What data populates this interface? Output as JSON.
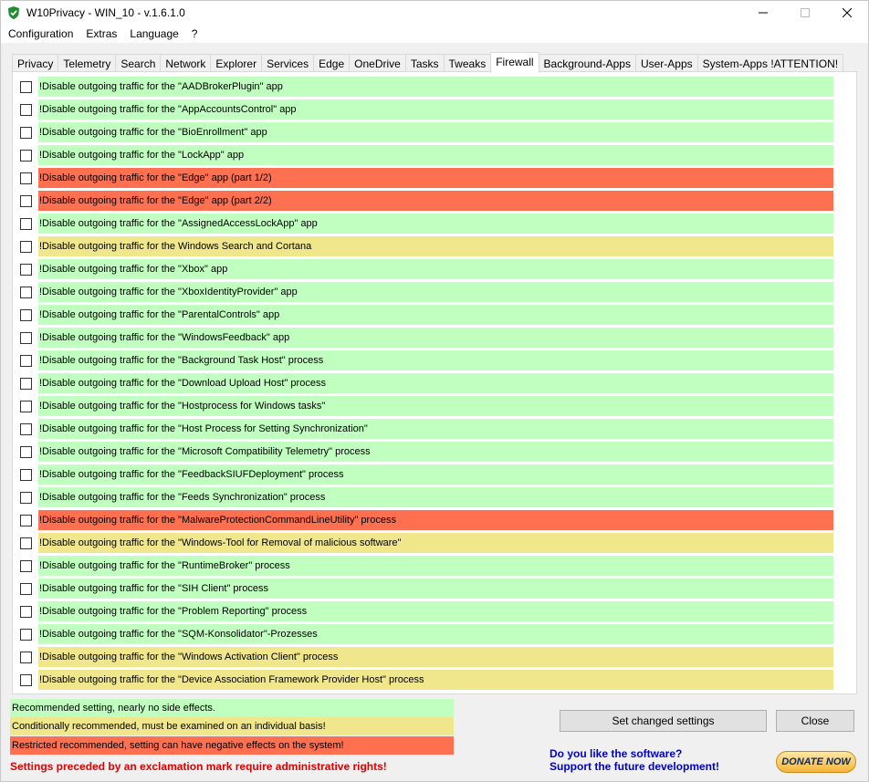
{
  "window": {
    "title": "W10Privacy - WIN_10 - v.1.6.1.0"
  },
  "menu": [
    "Configuration",
    "Extras",
    "Language",
    "?"
  ],
  "tabs": [
    "Privacy",
    "Telemetry",
    "Search",
    "Network",
    "Explorer",
    "Services",
    "Edge",
    "OneDrive",
    "Tasks",
    "Tweaks",
    "Firewall",
    "Background-Apps",
    "User-Apps",
    "System-Apps !ATTENTION!"
  ],
  "active_tab": "Firewall",
  "colors": {
    "green": "#c0ffc0",
    "yellow": "#f0e68c",
    "red": "#ff7050"
  },
  "rules": [
    {
      "label": "!Disable outgoing traffic for the \"AADBrokerPlugin\" app",
      "level": "green",
      "checked": false
    },
    {
      "label": "!Disable outgoing traffic for the \"AppAccountsControl\" app",
      "level": "green",
      "checked": false
    },
    {
      "label": "!Disable outgoing traffic for the \"BioEnrollment\" app",
      "level": "green",
      "checked": false
    },
    {
      "label": "!Disable outgoing traffic for the \"LockApp\" app",
      "level": "green",
      "checked": false
    },
    {
      "label": "!Disable outgoing traffic for the \"Edge\" app (part 1/2)",
      "level": "red",
      "checked": false
    },
    {
      "label": "!Disable outgoing traffic for the \"Edge\" app (part 2/2)",
      "level": "red",
      "checked": false
    },
    {
      "label": "!Disable outgoing traffic for the \"AssignedAccessLockApp\" app",
      "level": "green",
      "checked": false
    },
    {
      "label": "!Disable outgoing traffic for the Windows Search and Cortana",
      "level": "yellow",
      "checked": false
    },
    {
      "label": "!Disable outgoing traffic for the \"Xbox\" app",
      "level": "green",
      "checked": false
    },
    {
      "label": "!Disable outgoing traffic for the \"XboxIdentityProvider\" app",
      "level": "green",
      "checked": false
    },
    {
      "label": "!Disable outgoing traffic for the \"ParentalControls\" app",
      "level": "green",
      "checked": false
    },
    {
      "label": "!Disable outgoing traffic for the \"WindowsFeedback\" app",
      "level": "green",
      "checked": false
    },
    {
      "label": "!Disable outgoing traffic for the \"Background Task Host\" process",
      "level": "green",
      "checked": false
    },
    {
      "label": "!Disable outgoing traffic for the \"Download Upload Host\" process",
      "level": "green",
      "checked": false
    },
    {
      "label": "!Disable outgoing traffic for the \"Hostprocess for Windows tasks\"",
      "level": "green",
      "checked": false
    },
    {
      "label": "!Disable outgoing traffic for the \"Host Process for Setting Synchronization\"",
      "level": "green",
      "checked": false
    },
    {
      "label": "!Disable outgoing traffic for the \"Microsoft Compatibility Telemetry\" process",
      "level": "green",
      "checked": false
    },
    {
      "label": "!Disable outgoing traffic for the \"FeedbackSIUFDeployment\" process",
      "level": "green",
      "checked": false
    },
    {
      "label": "!Disable outgoing traffic for the \"Feeds Synchronization\" process",
      "level": "green",
      "checked": false
    },
    {
      "label": "!Disable outgoing traffic for the \"MalwareProtectionCommandLineUtility\" process",
      "level": "red",
      "checked": false
    },
    {
      "label": "!Disable outgoing traffic for the \"Windows-Tool for Removal of malicious software\"",
      "level": "yellow",
      "checked": false
    },
    {
      "label": "!Disable outgoing traffic for the \"RuntimeBroker\" process",
      "level": "green",
      "checked": false
    },
    {
      "label": "!Disable outgoing traffic for the \"SIH Client\" process",
      "level": "green",
      "checked": false
    },
    {
      "label": "!Disable outgoing traffic for the \"Problem Reporting\" process",
      "level": "green",
      "checked": false
    },
    {
      "label": "!Disable outgoing traffic for the \"SQM-Konsolidator\"-Prozesses",
      "level": "green",
      "checked": false
    },
    {
      "label": "!Disable outgoing traffic for the \"Windows Activation Client\" process",
      "level": "yellow",
      "checked": false
    },
    {
      "label": "!Disable outgoing traffic for the \"Device Association Framework Provider Host\" process",
      "level": "yellow",
      "checked": false
    }
  ],
  "legend": {
    "green": "Recommended setting, nearly no side effects.",
    "yellow": "Conditionally recommended, must be examined on an individual basis!",
    "red": "Restricted recommended, setting can have negative effects on the system!"
  },
  "admin_note": "Settings preceded by an exclamation mark require administrative rights!",
  "buttons": {
    "set_changed": "Set changed settings",
    "close": "Close"
  },
  "donate": {
    "line1": "Do you like the software?",
    "line2": "Support the future development!",
    "button": "DONATE NOW"
  }
}
